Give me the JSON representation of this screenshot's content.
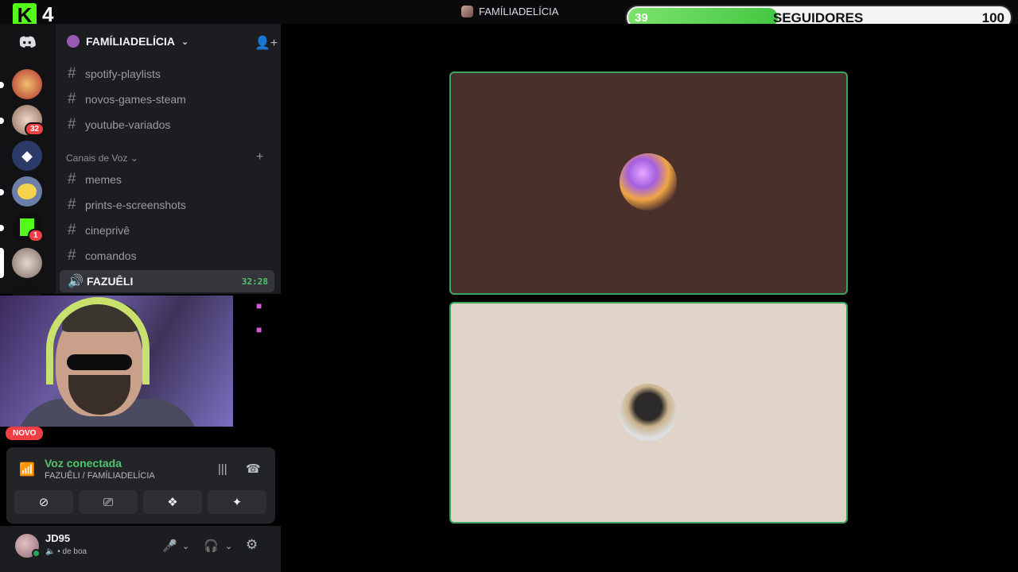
{
  "window": {
    "title": "FAMÍLIADELÍCIA"
  },
  "overlay": {
    "kick_count": "4",
    "followers": {
      "current": "39",
      "label": "SEGUIDORES",
      "goal": "100",
      "progress": 0.39
    }
  },
  "rail": {
    "badges": [
      "32",
      "1"
    ]
  },
  "server": {
    "name": "FAMÍLIADELÍCIA",
    "text_channels": [
      "spotify-playlists",
      "novos-games-steam",
      "youtube-variados"
    ],
    "voice_category": "Canais de Voz",
    "voice_channels": [
      "memes",
      "prints-e-screenshots",
      "cineprivê",
      "comandos"
    ],
    "active_voice": {
      "name": "FAZUÊLI",
      "timer": "32:28"
    }
  },
  "novo_badge": "NOVO",
  "voice_panel": {
    "status": "Voz conectada",
    "location": "FAZUÊLI / FAMÍLIADELÍCIA"
  },
  "user": {
    "name": "JD95",
    "status": "de boa"
  }
}
